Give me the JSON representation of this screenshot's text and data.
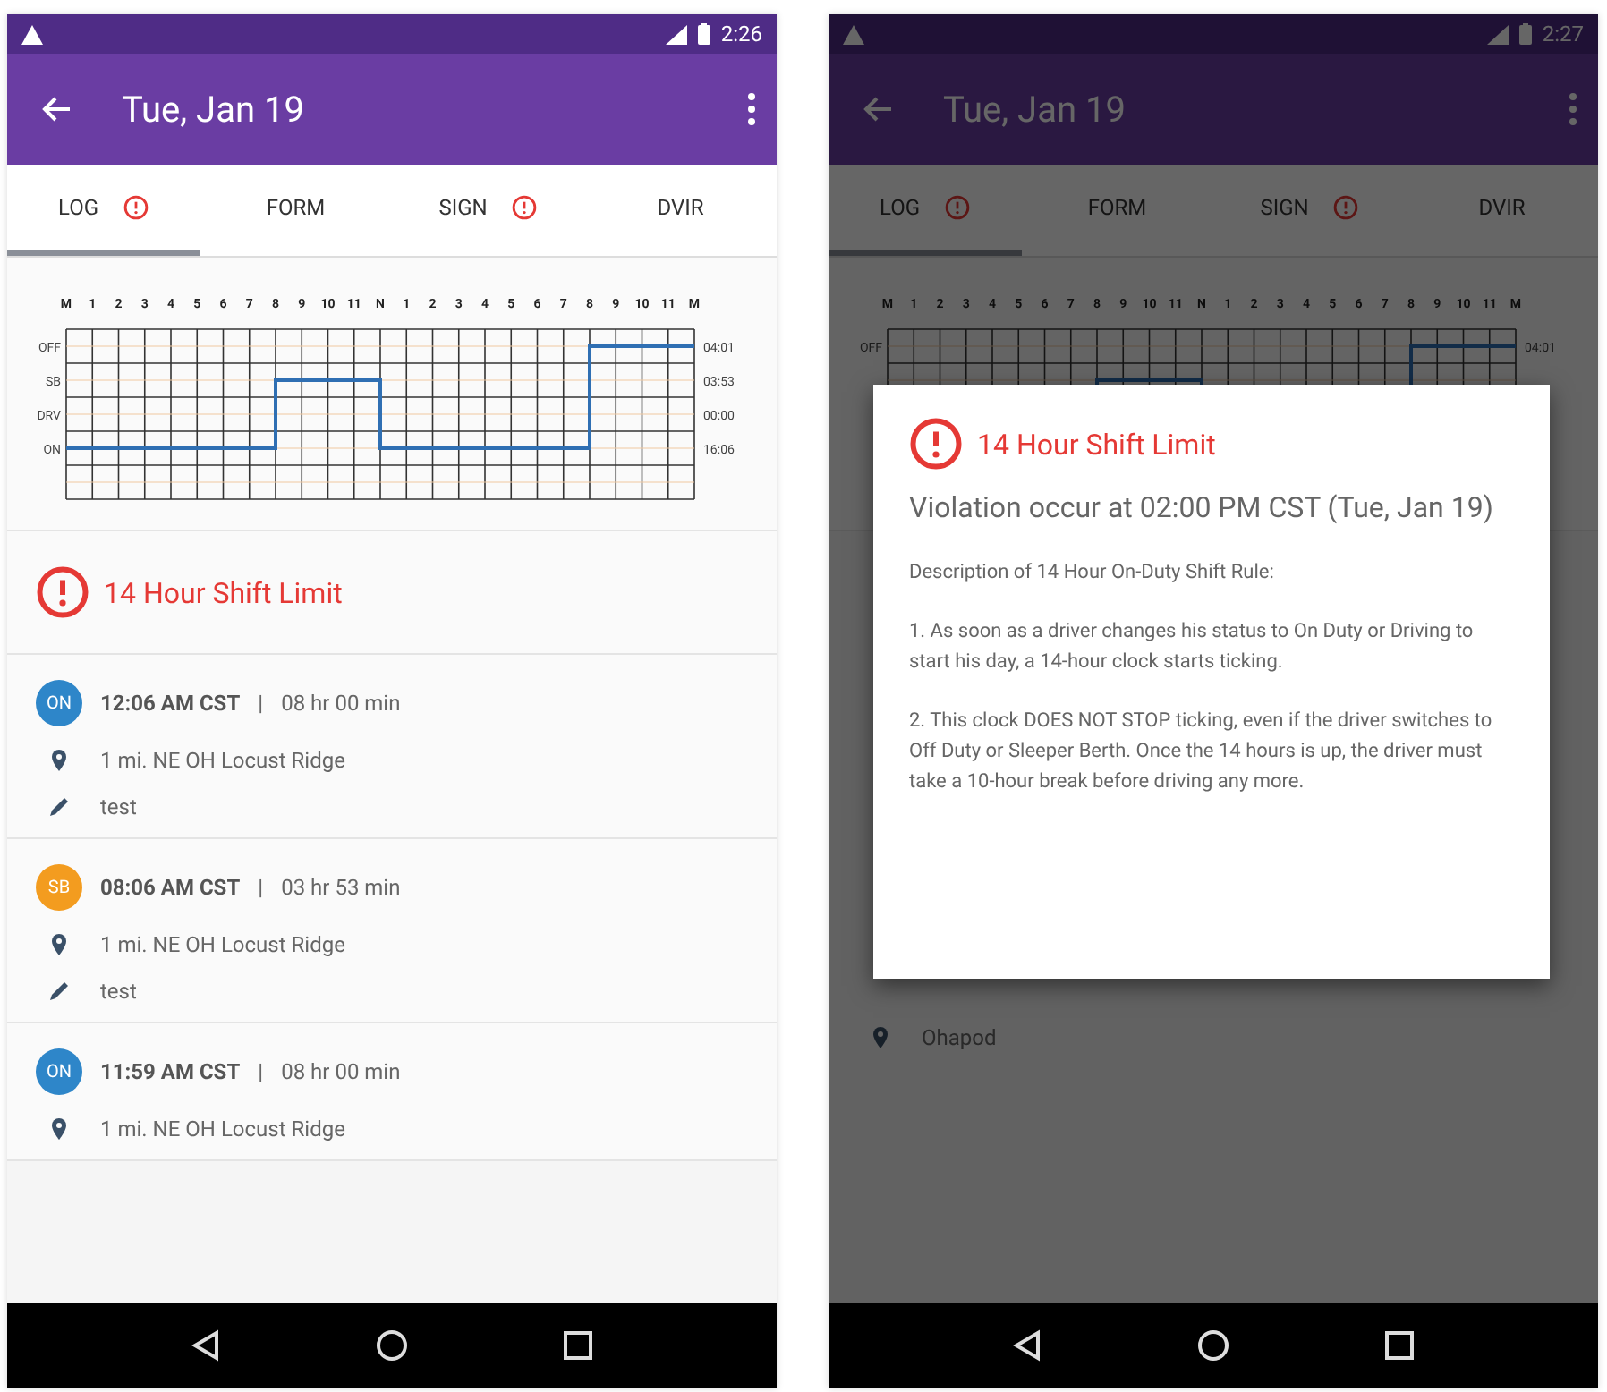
{
  "screens": [
    {
      "dimmed": false,
      "status_time": "2:26",
      "title": "Tue, Jan 19",
      "tabs": [
        {
          "label": "LOG",
          "selected": true,
          "alert": true
        },
        {
          "label": "FORM",
          "selected": false,
          "alert": false
        },
        {
          "label": "SIGN",
          "selected": false,
          "alert": true
        },
        {
          "label": "DVIR",
          "selected": false,
          "alert": false
        }
      ],
      "chart": {
        "hours": [
          "M",
          "1",
          "2",
          "3",
          "4",
          "5",
          "6",
          "7",
          "8",
          "9",
          "10",
          "11",
          "N",
          "1",
          "2",
          "3",
          "4",
          "5",
          "6",
          "7",
          "8",
          "9",
          "10",
          "11",
          "M"
        ],
        "rows": [
          {
            "label": "OFF",
            "total": "04:01"
          },
          {
            "label": "SB",
            "total": "03:53"
          },
          {
            "label": "DRV",
            "total": "00:00"
          },
          {
            "label": "ON",
            "total": "16:06"
          }
        ]
      },
      "violation": {
        "title": "14 Hour Shift Limit"
      },
      "entries": [
        {
          "kind": "full",
          "status": "ON",
          "color": "#2e86c9",
          "time": "12:06 AM CST",
          "separator": "|",
          "duration": "08 hr 00 min",
          "location": "1 mi. NE OH Locust Ridge",
          "note": "test"
        },
        {
          "kind": "full",
          "status": "SB",
          "color": "#f39c1f",
          "time": "08:06 AM CST",
          "separator": "|",
          "duration": "03 hr 53 min",
          "location": "1 mi. NE OH Locust Ridge",
          "note": "test"
        },
        {
          "kind": "full",
          "status": "ON",
          "color": "#2e86c9",
          "time": "11:59 AM CST",
          "separator": "|",
          "duration": "08 hr 00 min",
          "location": "1 mi. NE OH Locust Ridge"
        }
      ]
    },
    {
      "dimmed": true,
      "status_time": "2:27",
      "title": "Tue, Jan 19",
      "tabs": [
        {
          "label": "LOG",
          "selected": true,
          "alert": true
        },
        {
          "label": "FORM",
          "selected": false,
          "alert": false
        },
        {
          "label": "SIGN",
          "selected": false,
          "alert": true
        },
        {
          "label": "DVIR",
          "selected": false,
          "alert": false
        }
      ],
      "chart": {
        "hours": [
          "M",
          "1",
          "2",
          "3",
          "4",
          "5",
          "6",
          "7",
          "8",
          "9",
          "10",
          "11",
          "N",
          "1",
          "2",
          "3",
          "4",
          "5",
          "6",
          "7",
          "8",
          "9",
          "10",
          "11",
          "M"
        ],
        "rows": [
          {
            "label": "OFF",
            "total": "04:01"
          }
        ]
      },
      "entries": [
        {
          "kind": "partial",
          "location": "Ohapod"
        }
      ],
      "dialog": {
        "title": "14 Hour Shift Limit",
        "headline": "Violation occur at 02:00 PM CST (Tue, Jan 19)",
        "paragraphs": [
          "Description of 14 Hour On-Duty Shift Rule:",
          "1. As soon as a driver changes his status to On Duty or Driving to start his day, a 14-hour clock starts ticking.",
          "2. This clock DOES NOT STOP ticking, even if the driver switches to Off Duty or Sleeper Berth. Once the 14 hours is up, the driver must take a 10-hour break before driving any more."
        ]
      }
    }
  ]
}
